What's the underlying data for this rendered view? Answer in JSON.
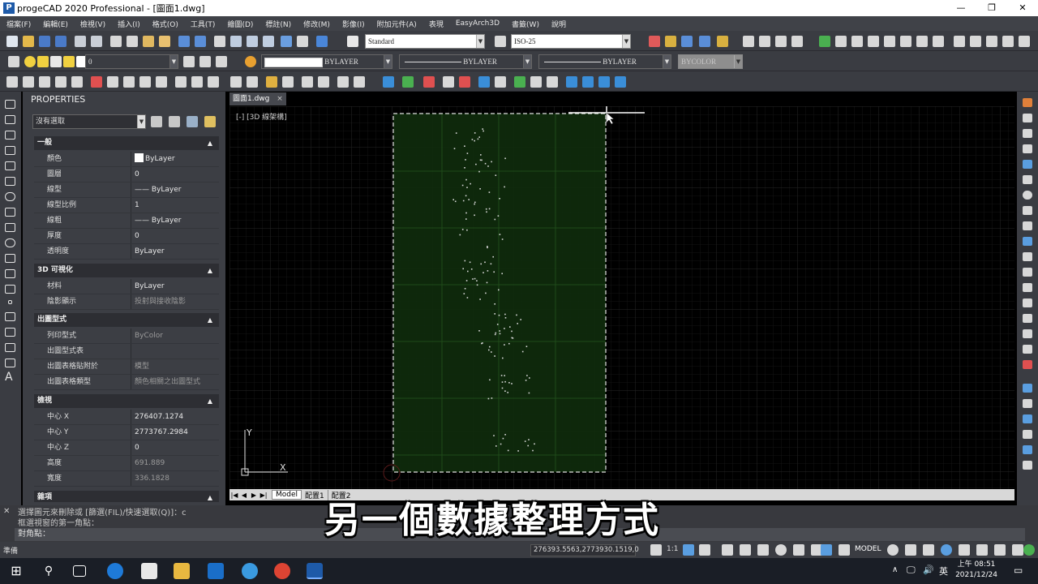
{
  "window": {
    "title": "progeCAD 2020 Professional - [圖面1.dwg]",
    "minimize": "—",
    "maximize": "❐",
    "close": "✕"
  },
  "menu": [
    "檔案(F)",
    "編輯(E)",
    "檢視(V)",
    "插入(I)",
    "格式(O)",
    "工具(T)",
    "繪圖(D)",
    "標註(N)",
    "修改(M)",
    "影像(I)",
    "附加元件(A)",
    "表現",
    "EasyArch3D",
    "書籤(W)",
    "說明"
  ],
  "toolbar": {
    "text_style": "Standard",
    "dim_style": "ISO-25",
    "layer": "0",
    "color": "BYLAYER",
    "linetype": "BYLAYER",
    "lineweight": "BYLAYER",
    "plot_style": "BYCOLOR"
  },
  "properties": {
    "title": "PROPERTIES",
    "selection": "沒有選取",
    "sections": {
      "general": {
        "title": "一般",
        "rows": [
          {
            "k": "顏色",
            "v": "ByLayer"
          },
          {
            "k": "圖層",
            "v": "0"
          },
          {
            "k": "線型",
            "v": "—— ByLayer"
          },
          {
            "k": "線型比例",
            "v": "1"
          },
          {
            "k": "線粗",
            "v": "—— ByLayer"
          },
          {
            "k": "厚度",
            "v": "0"
          },
          {
            "k": "透明度",
            "v": "ByLayer"
          }
        ]
      },
      "viz3d": {
        "title": "3D 可視化",
        "rows": [
          {
            "k": "材料",
            "v": "ByLayer"
          },
          {
            "k": "陰影顯示",
            "v": "投射與接收陰影"
          }
        ]
      },
      "plot": {
        "title": "出圖型式",
        "rows": [
          {
            "k": "列印型式",
            "v": "ByColor"
          },
          {
            "k": "出圖型式表",
            "v": ""
          },
          {
            "k": "出圖表格貼附於",
            "v": "模型"
          },
          {
            "k": "出圖表格類型",
            "v": "顏色相關之出圖型式"
          }
        ]
      },
      "view": {
        "title": "檢視",
        "rows": [
          {
            "k": "中心 X",
            "v": "276407.1274"
          },
          {
            "k": "中心 Y",
            "v": "2773767.2984"
          },
          {
            "k": "中心 Z",
            "v": "0"
          },
          {
            "k": "高度",
            "v": "691.889"
          },
          {
            "k": "寬度",
            "v": "336.1828"
          }
        ]
      },
      "misc": {
        "title": "雜項"
      }
    }
  },
  "drawing": {
    "tab": "圖面1.dwg",
    "close": "×",
    "view_label": "[-] [3D 線架構]",
    "ucs_y": "Y",
    "ucs_x": "X"
  },
  "layout_tabs": [
    "Model",
    "配置1",
    "配置2"
  ],
  "command": {
    "line1": "選擇圖元來刪除或 [篩選(FIL)/快速選取(Q)]：c",
    "line2": "框選視窗的第一角點：",
    "prompt": "對角點："
  },
  "subtitle": "另一個數據整理方式",
  "status": {
    "ready": "準備",
    "coords": "276393.5563,2773930.1519,0",
    "scale": "1:1",
    "model": "MODEL"
  },
  "taskbar": {
    "time": "上午 08:51",
    "date": "2021/12/24",
    "ime": "英"
  }
}
